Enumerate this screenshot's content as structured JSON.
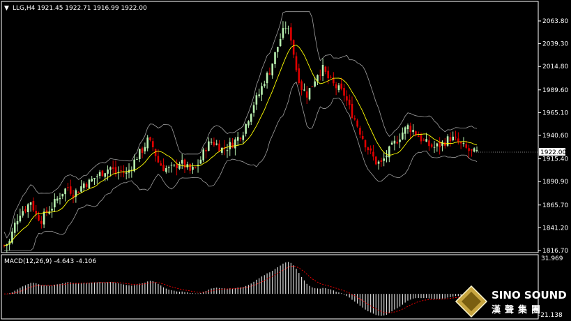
{
  "header": {
    "symbol_arrow": "▼",
    "symbol_text": "LLG,H4  1921.45 1922.71 1916.99 1922.00"
  },
  "macd": {
    "label": "MACD(12,26,9) -4.643 -4.106",
    "axis_top": "31.969",
    "axis_bottom": "-21.138",
    "ylim": [
      -21.138,
      31.969
    ]
  },
  "price_axis": {
    "ticks": [
      "2063.80",
      "2039.30",
      "2014.80",
      "1989.60",
      "1965.10",
      "1940.60",
      "1915.40",
      "1890.90",
      "1865.70",
      "1841.20",
      "1816.70"
    ],
    "current_price": "1922.00",
    "ylim": [
      1816.7,
      2063.8
    ]
  },
  "logo": {
    "en": "SINO SOUND",
    "cn": "漢聲集團"
  },
  "colors": {
    "background": "#000000",
    "bull": "#b8f0b0",
    "bear": "#e00000",
    "ma": "#ffff00",
    "bands": "#a0a0a0",
    "macd_hist": "#d8d8d8",
    "macd_signal": "#ff0000",
    "grid_border": "#ffffff"
  },
  "chart_data": {
    "type": "candlestick",
    "close_path": [
      1822,
      1826,
      1845,
      1858,
      1862,
      1870,
      1855,
      1850,
      1858,
      1864,
      1872,
      1880,
      1885,
      1878,
      1882,
      1889,
      1890,
      1895,
      1899,
      1903,
      1906,
      1900,
      1902,
      1899,
      1908,
      1918,
      1925,
      1935,
      1928,
      1912,
      1906,
      1904,
      1906,
      1912,
      1908,
      1902,
      1905,
      1915,
      1928,
      1934,
      1931,
      1926,
      1928,
      1932,
      1938,
      1945,
      1960,
      1975,
      1985,
      2000,
      2010,
      2028,
      2045,
      2058,
      2046,
      2012,
      1992,
      1985,
      1995,
      2008,
      2012,
      2002,
      1995,
      1990,
      1985,
      1970,
      1958,
      1945,
      1932,
      1921,
      1912,
      1910,
      1920,
      1928,
      1936,
      1944,
      1950,
      1946,
      1940,
      1934,
      1930,
      1928,
      1930,
      1934,
      1938,
      1935,
      1930,
      1926,
      1922,
      1922
    ],
    "note_ylim": [
      1816.7,
      2063.8
    ]
  }
}
